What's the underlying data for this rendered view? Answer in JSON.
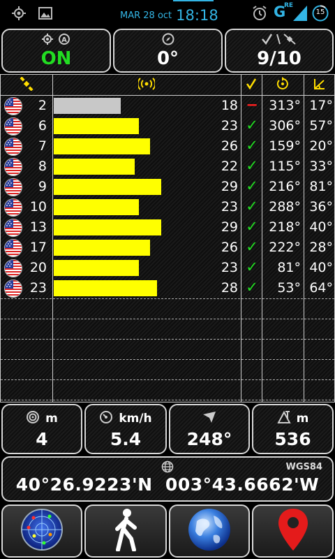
{
  "status_bar": {
    "date": "MAR 28 oct",
    "time": "18:18",
    "network": "G",
    "network_sup": "RE",
    "battery": "15"
  },
  "top_panels": {
    "fix_status": "ON",
    "heading": "0°",
    "satellites": "9/10"
  },
  "satellites": [
    {
      "prn": "2",
      "snr": "18",
      "used": false,
      "azimuth": "313°",
      "elevation": "17°",
      "signal": 0.48
    },
    {
      "prn": "6",
      "snr": "23",
      "used": true,
      "azimuth": "306°",
      "elevation": "57°",
      "signal": 0.61
    },
    {
      "prn": "7",
      "snr": "26",
      "used": true,
      "azimuth": "159°",
      "elevation": "20°",
      "signal": 0.69
    },
    {
      "prn": "8",
      "snr": "22",
      "used": true,
      "azimuth": "115°",
      "elevation": "33°",
      "signal": 0.58
    },
    {
      "prn": "9",
      "snr": "29",
      "used": true,
      "azimuth": "216°",
      "elevation": "81°",
      "signal": 0.77
    },
    {
      "prn": "10",
      "snr": "23",
      "used": true,
      "azimuth": "288°",
      "elevation": "36°",
      "signal": 0.61
    },
    {
      "prn": "13",
      "snr": "29",
      "used": true,
      "azimuth": "218°",
      "elevation": "40°",
      "signal": 0.77
    },
    {
      "prn": "17",
      "snr": "26",
      "used": true,
      "azimuth": "222°",
      "elevation": "28°",
      "signal": 0.69
    },
    {
      "prn": "20",
      "snr": "23",
      "used": true,
      "azimuth": "81°",
      "elevation": "40°",
      "signal": 0.61
    },
    {
      "prn": "23",
      "snr": "28",
      "used": true,
      "azimuth": "53°",
      "elevation": "64°",
      "signal": 0.74
    }
  ],
  "used_mark": "✓",
  "unused_mark": "−",
  "stats": {
    "accuracy_unit": "m",
    "accuracy": "4",
    "speed_unit": "km/h",
    "speed": "5.4",
    "bearing": "248°",
    "altitude_unit": "m",
    "altitude": "536"
  },
  "coordinates": {
    "datum": "WGS84",
    "text": "40°26.9223'N  003°43.6662'W"
  },
  "colors": {
    "accent": "#33b5e5",
    "fix_on": "#22dd22",
    "bar_strong": "#ffff00",
    "bar_weak": "#c8c8c8",
    "check": "#22dd22",
    "unused": "#ff2020",
    "header_icon": "#ffdd00"
  },
  "nav": [
    "radar-button",
    "walk-button",
    "globe-button",
    "map-pin-button"
  ]
}
